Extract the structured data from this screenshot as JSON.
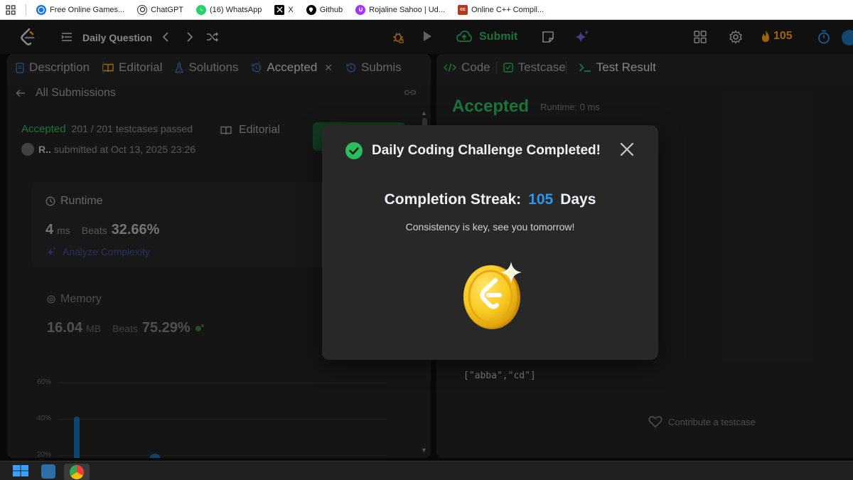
{
  "bookmarks": [
    {
      "label": "Free Online Games...",
      "color": "#1a73e8",
      "icon": "globe-icon"
    },
    {
      "label": "ChatGPT",
      "color": "#333333",
      "icon": "chatgpt-icon"
    },
    {
      "label": "(16) WhatsApp",
      "color": "#25d366",
      "icon": "whatsapp-icon"
    },
    {
      "label": "X",
      "color": "#000000",
      "icon": "x-icon"
    },
    {
      "label": "Github",
      "color": "#000000",
      "icon": "github-icon"
    },
    {
      "label": "Rojaline Sahoo | Ud...",
      "color": "#a435f0",
      "icon": "udemy-icon"
    },
    {
      "label": "Online C++ Compil...",
      "color": "#b33a1a",
      "icon": "cc-icon"
    }
  ],
  "nav": {
    "title": "Daily Question",
    "submit_label": "Submit",
    "streak_count": "105"
  },
  "left": {
    "tabs": [
      {
        "label": "Description",
        "icon": "document-icon"
      },
      {
        "label": "Editorial",
        "icon": "book-icon"
      },
      {
        "label": "Solutions",
        "icon": "flask-icon"
      },
      {
        "label": "Accepted",
        "icon": "history-icon",
        "active": true
      },
      {
        "label": "Submis",
        "icon": "history-icon"
      }
    ],
    "back_label": "All Submissions",
    "status": "Accepted",
    "testcases": "201 / 201 testcases passed",
    "user": "R..",
    "submitted": "submitted at Oct 13, 2025 23:26",
    "editorial_label": "Editorial",
    "runtime": {
      "title": "Runtime",
      "value": "4",
      "unit": "ms",
      "beats_label": "Beats",
      "beats": "32.66%",
      "analyze_label": "Analyze Complexity"
    },
    "memory": {
      "title": "Memory",
      "value": "16.04",
      "unit": "MB",
      "beats_label": "Beats",
      "beats": "75.29%"
    },
    "chart_ticks": [
      "60%",
      "40%",
      "20%"
    ]
  },
  "right": {
    "tabs": [
      {
        "label": "Code",
        "icon": "code-icon"
      },
      {
        "label": "Testcase",
        "icon": "checkbox-icon"
      },
      {
        "label": "Test Result",
        "icon": "terminal-icon",
        "active": true
      }
    ],
    "result": "Accepted",
    "runtime": "Runtime: 0 ms",
    "output": "[\"abba\",\"cd\"]",
    "contribute": "Contribute a testcase"
  },
  "modal": {
    "title": "Daily Coding Challenge Completed!",
    "streak_label": "Completion Streak:",
    "streak_days": "105",
    "days_label": "Days",
    "subtitle": "Consistency is key, see you tomorrow!"
  },
  "colors": {
    "accent_green": "#2cbb5d",
    "streak_orange": "#ffa116",
    "streak_blue": "#2d95ec"
  }
}
